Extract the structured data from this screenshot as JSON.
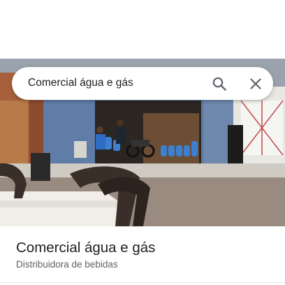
{
  "search": {
    "query": "Comercial água e gás"
  },
  "icons": {
    "search": "search-icon",
    "close": "close-icon"
  },
  "place": {
    "name": "Comercial água e gás",
    "category": "Distribuidora de bebidas"
  },
  "colors": {
    "title_text": "#202124",
    "secondary_text": "#5f6368",
    "icon": "#5f6368",
    "storefront_blue": "#5f7da6"
  }
}
